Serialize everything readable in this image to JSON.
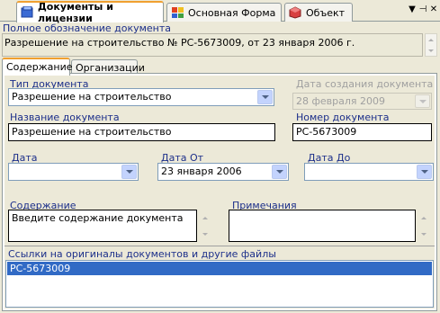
{
  "window": {
    "tabs": [
      {
        "label": "Документы и лицензии",
        "icon": "documents-icon",
        "active": true
      },
      {
        "label": "Основная Форма",
        "icon": "form-icon",
        "active": false
      },
      {
        "label": "Объект",
        "icon": "object-icon",
        "active": false
      }
    ],
    "controls": {
      "menu": "▼",
      "pin": "⊣",
      "close": "✕"
    }
  },
  "full_name": {
    "label": "Полное обозначение документа",
    "value": "Разрешение на строительство № РС-5673009, от 23 января 2006 г."
  },
  "inner_tabs": [
    {
      "label": "Содержание",
      "active": true
    },
    {
      "label": "Организации",
      "active": false
    }
  ],
  "form": {
    "doc_type": {
      "label": "Тип документа",
      "value": "Разрешение на строительство"
    },
    "created_date": {
      "label": "Дата создания документа",
      "value": "28 февраля  2009"
    },
    "doc_name": {
      "label": "Название документа",
      "value": "Разрешение на строительство"
    },
    "doc_number": {
      "label": "Номер документа",
      "value": "РС-5673009"
    },
    "date": {
      "label": "Дата",
      "value": ""
    },
    "date_from": {
      "label": "Дата От",
      "value": "23  января   2006"
    },
    "date_to": {
      "label": "Дата До",
      "value": ""
    },
    "content": {
      "label": "Содержание",
      "value": "Введите содержание документа"
    },
    "notes": {
      "label": "Примечания",
      "value": ""
    }
  },
  "links": {
    "label": "Ссылки на оригиналы документов и другие файлы",
    "items": [
      "РС-5673009"
    ]
  },
  "colors": {
    "accent": "#f0a030",
    "label": "#1c2f8a",
    "selection": "#316ac5"
  }
}
